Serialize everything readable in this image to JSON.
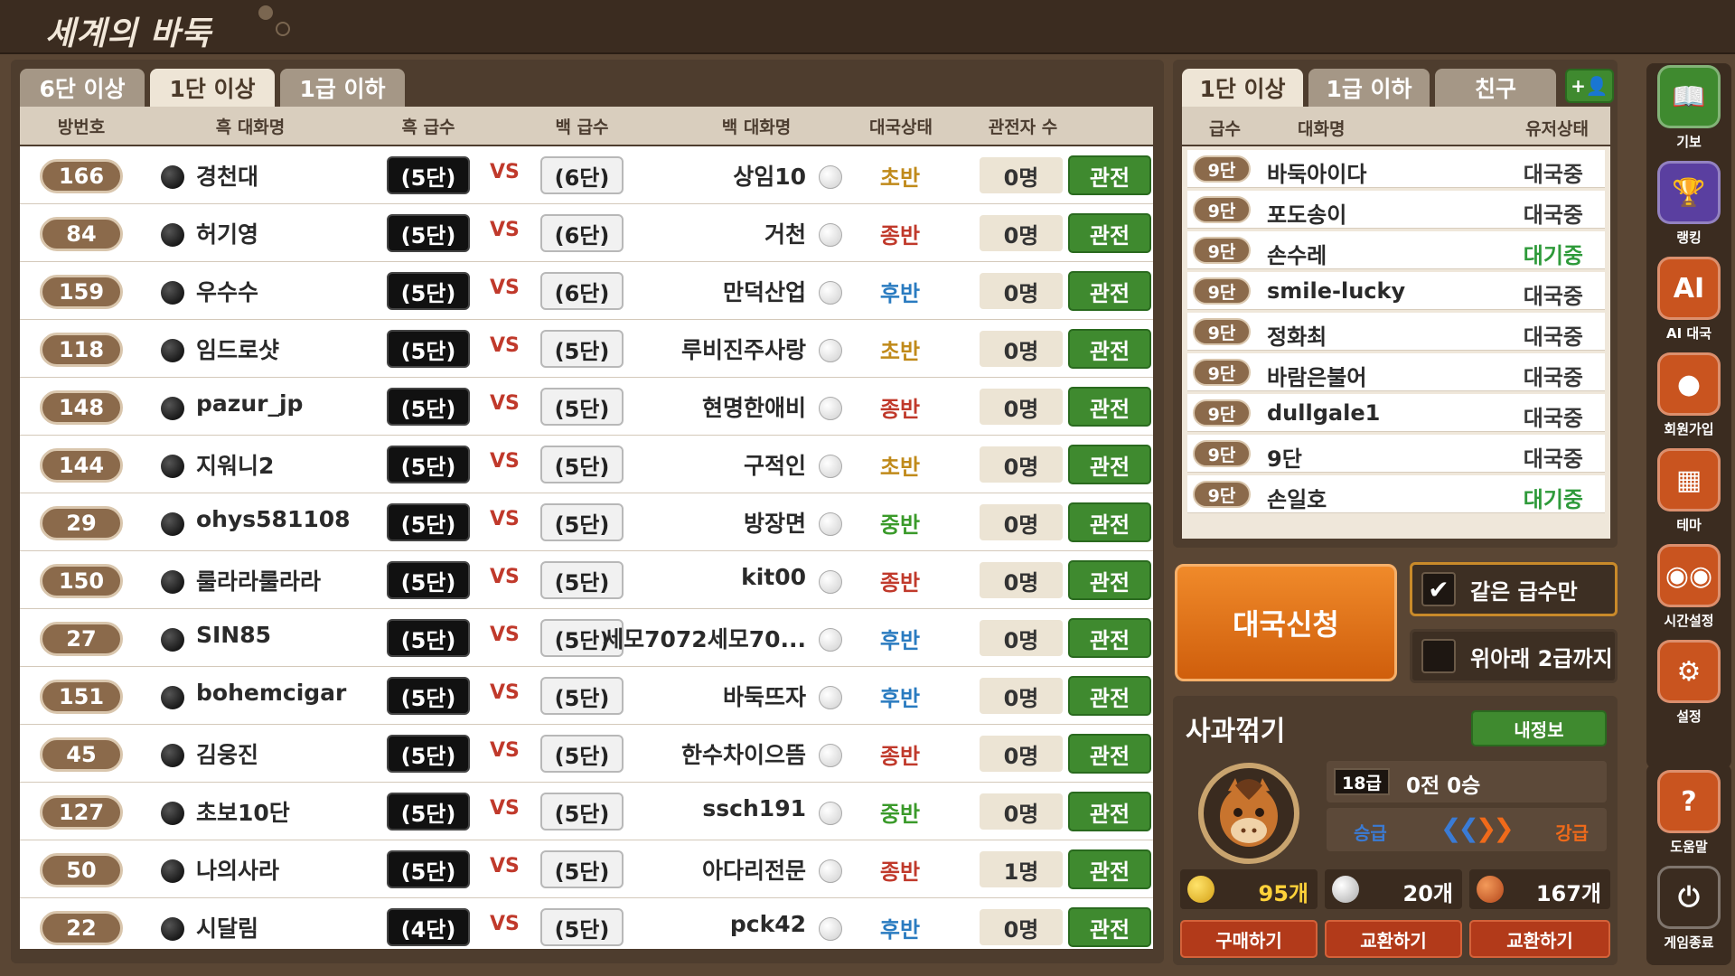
{
  "app": {
    "title": "세계의 바둑"
  },
  "games": {
    "tabs": [
      "6단 이상",
      "1단 이상",
      "1급 이하"
    ],
    "active_tab": 1,
    "headers": {
      "room": "방번호",
      "black": "흑 대화명",
      "black_rank": "흑 급수",
      "white_rank": "백 급수",
      "white": "백 대화명",
      "state": "대국상태",
      "spectators": "관전자 수"
    },
    "vs_label": "VS",
    "watch_label": "관전",
    "rows": [
      {
        "room": "166",
        "black": "경천대",
        "black_rank": "(5단)",
        "white_rank": "(6단)",
        "white": "상임10",
        "state": "초반",
        "spectators": "0명"
      },
      {
        "room": "84",
        "black": "허기영",
        "black_rank": "(5단)",
        "white_rank": "(6단)",
        "white": "거천",
        "state": "종반",
        "spectators": "0명"
      },
      {
        "room": "159",
        "black": "우수수",
        "black_rank": "(5단)",
        "white_rank": "(6단)",
        "white": "만덕산업",
        "state": "후반",
        "spectators": "0명"
      },
      {
        "room": "118",
        "black": "임드로샷",
        "black_rank": "(5단)",
        "white_rank": "(5단)",
        "white": "루비진주사랑",
        "state": "초반",
        "spectators": "0명"
      },
      {
        "room": "148",
        "black": "pazur_jp",
        "black_rank": "(5단)",
        "white_rank": "(5단)",
        "white": "현명한애비",
        "state": "종반",
        "spectators": "0명"
      },
      {
        "room": "144",
        "black": "지워니2",
        "black_rank": "(5단)",
        "white_rank": "(5단)",
        "white": "구적인",
        "state": "초반",
        "spectators": "0명"
      },
      {
        "room": "29",
        "black": "ohys581108",
        "black_rank": "(5단)",
        "white_rank": "(5단)",
        "white": "방장면",
        "state": "중반",
        "spectators": "0명"
      },
      {
        "room": "150",
        "black": "룰라라룰라라",
        "black_rank": "(5단)",
        "white_rank": "(5단)",
        "white": "kit00",
        "state": "종반",
        "spectators": "0명"
      },
      {
        "room": "27",
        "black": "SIN85",
        "black_rank": "(5단)",
        "white_rank": "(5단)",
        "white": "세모7072세모70...",
        "state": "후반",
        "spectators": "0명"
      },
      {
        "room": "151",
        "black": "bohemcigar",
        "black_rank": "(5단)",
        "white_rank": "(5단)",
        "white": "바둑뜨자",
        "state": "후반",
        "spectators": "0명"
      },
      {
        "room": "45",
        "black": "김웅진",
        "black_rank": "(5단)",
        "white_rank": "(5단)",
        "white": "한수차이으뜸",
        "state": "종반",
        "spectators": "0명"
      },
      {
        "room": "127",
        "black": "초보10단",
        "black_rank": "(5단)",
        "white_rank": "(5단)",
        "white": "ssch191",
        "state": "중반",
        "spectators": "0명"
      },
      {
        "room": "50",
        "black": "나의사라",
        "black_rank": "(5단)",
        "white_rank": "(5단)",
        "white": "아다리전문",
        "state": "종반",
        "spectators": "1명"
      },
      {
        "room": "22",
        "black": "시달림",
        "black_rank": "(4단)",
        "white_rank": "(5단)",
        "white": "pck42",
        "state": "후반",
        "spectators": "0명"
      }
    ]
  },
  "state_colors": {
    "초반": "#c08a1a",
    "중반": "#3a9a2a",
    "후반": "#2a7bc0",
    "종반": "#c0392b"
  },
  "users": {
    "tabs": [
      "1단 이상",
      "1급 이하",
      "친구"
    ],
    "active_tab": 0,
    "add_friend_label": "+👤",
    "headers": {
      "rank": "급수",
      "name": "대화명",
      "status": "유저상태"
    },
    "rows": [
      {
        "rank": "9단",
        "name": "바둑아이다",
        "status": "대국중"
      },
      {
        "rank": "9단",
        "name": "포도송이",
        "status": "대국중"
      },
      {
        "rank": "9단",
        "name": "손수레",
        "status": "대기중"
      },
      {
        "rank": "9단",
        "name": "smile-lucky",
        "status": "대국중"
      },
      {
        "rank": "9단",
        "name": "정화최",
        "status": "대국중"
      },
      {
        "rank": "9단",
        "name": "바람은불어",
        "status": "대국중"
      },
      {
        "rank": "9단",
        "name": "dullgale1",
        "status": "대국중"
      },
      {
        "rank": "9단",
        "name": "9단",
        "status": "대국중"
      },
      {
        "rank": "9단",
        "name": "손일호",
        "status": "대기중"
      }
    ]
  },
  "match": {
    "apply_label": "대국신청",
    "same_rank_label": "같은 급수만",
    "same_rank_checked": true,
    "within2_label": "위아래 2급까지",
    "within2_checked": false
  },
  "profile": {
    "name": "사과꺾기",
    "my_info_label": "내정보",
    "level": "18급",
    "record": "0전 0승",
    "promote_label": "승급",
    "demote_label": "강급",
    "gold": "95개",
    "silver": "20개",
    "bronze": "167개",
    "buy_label": "구매하기",
    "exchange1_label": "교환하기",
    "exchange2_label": "교환하기"
  },
  "side_nav": [
    {
      "icon": "book-icon",
      "label": "기보",
      "color": "#3f8a2f"
    },
    {
      "icon": "trophy-icon",
      "label": "랭킹",
      "color": "#5a3fa0"
    },
    {
      "icon": "ai-chip-icon",
      "label": "AI 대국",
      "color": "#c9541f"
    },
    {
      "icon": "user-icon",
      "label": "회원가입",
      "color": "#c9541f"
    },
    {
      "icon": "board-icon",
      "label": "테마",
      "color": "#c9541f"
    },
    {
      "icon": "clock-icon",
      "label": "시간설정",
      "color": "#c9541f"
    },
    {
      "icon": "gear-icon",
      "label": "설정",
      "color": "#c9541f"
    },
    {
      "icon": "help-icon",
      "label": "도움말",
      "color": "#c9541f"
    },
    {
      "icon": "power-icon",
      "label": "게임종료",
      "color": "#3b2c20"
    }
  ]
}
